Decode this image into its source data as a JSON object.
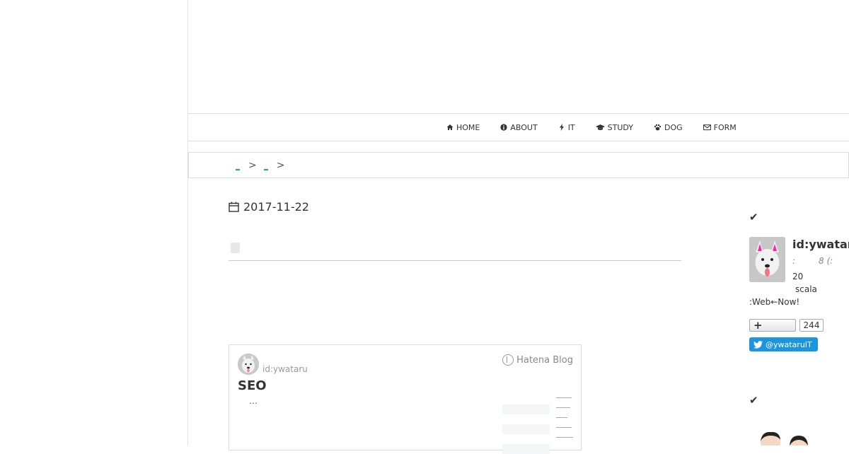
{
  "nav": {
    "items": [
      {
        "label": "HOME",
        "icon": "home-icon"
      },
      {
        "label": "ABOUT",
        "icon": "info-icon"
      },
      {
        "label": "IT",
        "icon": "bolt-icon"
      },
      {
        "label": "STUDY",
        "icon": "graduation-cap-icon"
      },
      {
        "label": "DOG",
        "icon": "paw-icon"
      },
      {
        "label": "FORM",
        "icon": "envelope-icon"
      }
    ]
  },
  "breadcrumb": {
    "separator": ">"
  },
  "article": {
    "date": "2017-11-22"
  },
  "embed": {
    "author": "id:ywataru",
    "title": "SEO",
    "excerpt": "…",
    "brand": "Hatena Blog"
  },
  "sidebar": {
    "profile": {
      "id": "id:ywataru",
      "meta_1": ":",
      "meta_2": "8 (:",
      "line_1": "20",
      "line_2": "scala",
      "line_3": ":Web←Now!"
    },
    "follow_count": "244",
    "twitter_label": "@ywataruIT"
  },
  "colors": {
    "accent_link": "#11aa99",
    "twitter_blue": "#1b95e0",
    "border": "#dddddd"
  }
}
